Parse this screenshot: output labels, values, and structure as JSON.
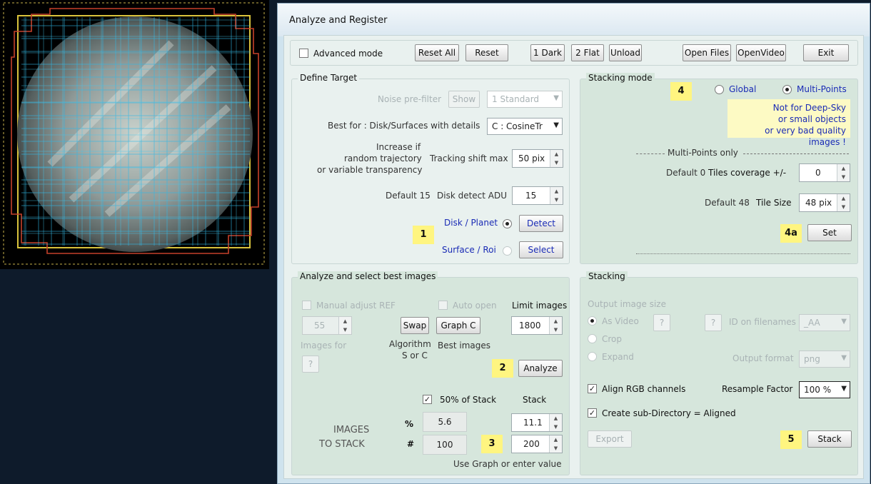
{
  "window": {
    "title": "Analyze and Register"
  },
  "toolbar": {
    "advanced_mode": "Advanced mode",
    "reset_all": "Reset All",
    "reset": "Reset",
    "dark": "1 Dark",
    "flat": "2 Flat",
    "unload": "Unload",
    "open_files": "Open Files",
    "open_video": "OpenVideo",
    "exit": "Exit"
  },
  "define_target": {
    "title": "Define Target",
    "noise_label": "Noise pre-filter",
    "noise_show": "Show",
    "noise_value": "1 Standard",
    "best_for_label": "Best for : Disk/Surfaces with details",
    "best_for_value": "C : CosineTr",
    "increase_line1": "Increase if",
    "increase_line2": "random trajectory",
    "increase_line3": "or variable transparency",
    "tracking_label": "Tracking shift max",
    "tracking_value": "50 pix",
    "default15": "Default 15",
    "disk_adu_label": "Disk detect ADU",
    "disk_adu_value": "15",
    "disk_planet": "Disk / Planet",
    "surface_roi": "Surface / Roi",
    "detect": "Detect",
    "select": "Select",
    "badge": "1"
  },
  "stacking_mode": {
    "title": "Stacking mode",
    "badge": "4",
    "global": "Global",
    "multi_points": "Multi-Points",
    "note1": "Not for Deep-Sky",
    "note2": "or small objects",
    "note3": "or very bad quality images !",
    "mp_only": "Multi-Points only",
    "default0": "Default 0",
    "tiles_cov_label": "Tiles coverage +/-",
    "tiles_cov_value": "0",
    "default48": "Default 48",
    "tile_size_label": "Tile Size",
    "tile_size_value": "48 pix",
    "badge4a": "4a",
    "set": "Set"
  },
  "analyze": {
    "title": "Analyze and select best images",
    "manual_adjust": "Manual adjust REF",
    "auto_open": "Auto open",
    "limit_images": "Limit images",
    "ref_value": "55",
    "swap": "Swap",
    "graph": "Graph C",
    "limit_value": "1800",
    "images_for": "Images for",
    "algorithm": "Algorithm",
    "s_or_c": "S or C",
    "best_images": "Best images",
    "q": "?",
    "badge2": "2",
    "analyze_btn": "Analyze",
    "pct_stack": "50% of Stack",
    "stack_hdr": "Stack",
    "images_to_stack1": "IMAGES",
    "images_to_stack2": "TO STACK",
    "pct_sym": "%",
    "num_sym": "#",
    "pct_value": "5.6",
    "num_value": "100",
    "badge3": "3",
    "stack_pct": "11.1",
    "stack_num": "200",
    "use_graph": "Use Graph or enter value"
  },
  "stacking": {
    "title": "Stacking",
    "output_size": "Output image size",
    "as_video": "As Video",
    "crop": "Crop",
    "expand": "Expand",
    "q1": "?",
    "q2": "?",
    "id_filenames": "ID on filenames",
    "id_value": "_AA",
    "output_format": "Output format",
    "format_value": "png",
    "align_rgb": "Align RGB channels",
    "resample_label": "Resample Factor",
    "resample_value": "100 %",
    "create_subdir": "Create sub-Directory = Aligned",
    "export": "Export",
    "badge5": "5",
    "stack_btn": "Stack"
  }
}
